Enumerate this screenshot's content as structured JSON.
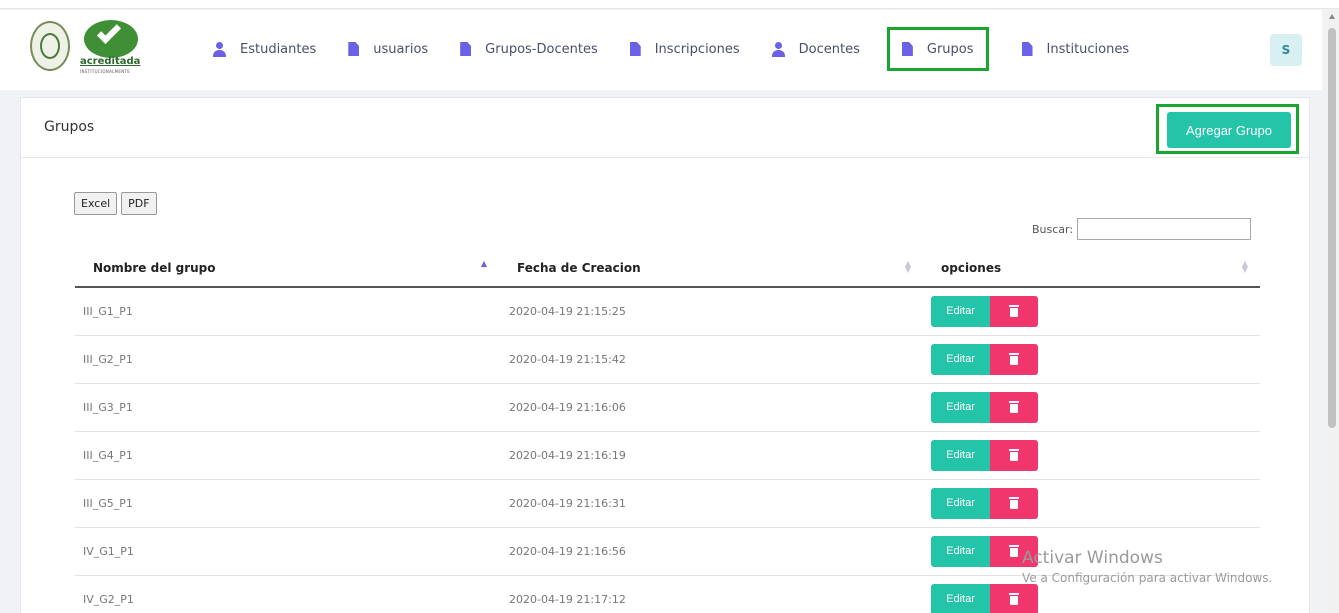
{
  "nav": {
    "items": [
      {
        "label": "Estudiantes",
        "icon": "user-icon"
      },
      {
        "label": "usuarios",
        "icon": "file-icon"
      },
      {
        "label": "Grupos-Docentes",
        "icon": "file-icon"
      },
      {
        "label": "Inscripciones",
        "icon": "file-icon"
      },
      {
        "label": "Docentes",
        "icon": "user-icon"
      },
      {
        "label": "Grupos",
        "icon": "file-icon",
        "active": true
      },
      {
        "label": "Instituciones",
        "icon": "file-icon"
      }
    ],
    "avatar": "S",
    "logo_text": "acreditada",
    "logo_subtext": "INSTITUCIONALMENTE"
  },
  "page": {
    "title": "Grupos",
    "add_button": "Agregar Grupo"
  },
  "table": {
    "export_excel": "Excel",
    "export_pdf": "PDF",
    "search_label": "Buscar:",
    "search_value": "",
    "columns": [
      "Nombre del grupo",
      "Fecha de Creacion",
      "opciones"
    ],
    "sorted_column": "Nombre del grupo",
    "sort_direction": "asc",
    "edit_label": "Editar",
    "rows": [
      {
        "name": "III_G1_P1",
        "date": "2020-04-19 21:15:25"
      },
      {
        "name": "III_G2_P1",
        "date": "2020-04-19 21:15:42"
      },
      {
        "name": "III_G3_P1",
        "date": "2020-04-19 21:16:06"
      },
      {
        "name": "III_G4_P1",
        "date": "2020-04-19 21:16:19"
      },
      {
        "name": "III_G5_P1",
        "date": "2020-04-19 21:16:31"
      },
      {
        "name": "IV_G1_P1",
        "date": "2020-04-19 21:16:56"
      },
      {
        "name": "IV_G2_P1",
        "date": "2020-04-19 21:17:12"
      }
    ]
  },
  "watermark": {
    "line1": "Activar Windows",
    "line2": "Ve a Configuración para activar Windows."
  },
  "colors": {
    "accent": "#6b61e6",
    "edit": "#23c4a7",
    "delete": "#f1356d",
    "highlight": "#1aa531"
  }
}
